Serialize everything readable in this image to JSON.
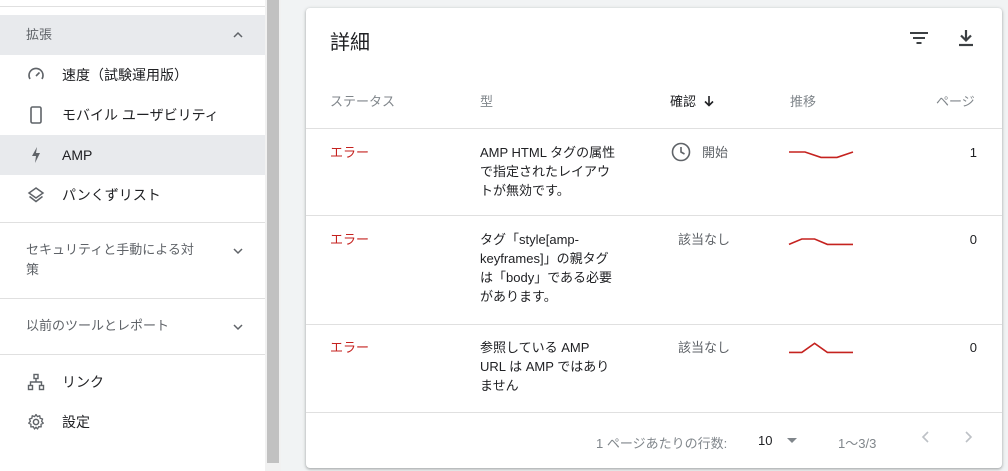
{
  "sidebar": {
    "sections": {
      "enhancements": "拡張",
      "security": "セキュリティと手動による対策",
      "legacy": "以前のツールとレポート"
    },
    "items": [
      {
        "label": "速度（試験運用版）",
        "icon": "speedometer-icon"
      },
      {
        "label": "モバイル ユーザビリティ",
        "icon": "smartphone-icon"
      },
      {
        "label": "AMP",
        "icon": "bolt-icon"
      },
      {
        "label": "パンくずリスト",
        "icon": "layers-icon"
      }
    ],
    "bottom_items": [
      {
        "label": "リンク",
        "icon": "sitemap-icon"
      },
      {
        "label": "設定",
        "icon": "gear-icon"
      }
    ]
  },
  "card": {
    "title": "詳細",
    "columns": {
      "status": "ステータス",
      "type": "型",
      "confirm": "確認",
      "trend": "推移",
      "pages": "ページ"
    },
    "rows": [
      {
        "status": "エラー",
        "type": "AMP HTML タグの属性で指定されたレイアウトが無効です。",
        "confirm": "開始",
        "pages": "1",
        "trend": [
          0.5,
          0.5,
          0.95,
          0.95,
          0.5
        ]
      },
      {
        "status": "エラー",
        "type": "タグ「style[amp-keyframes]」の親タグは「body」である必要があります。",
        "confirm": "該当なし",
        "pages": "0",
        "trend": [
          0.95,
          0.5,
          0.5,
          0.95,
          0.95,
          0.95
        ]
      },
      {
        "status": "エラー",
        "type": "参照している AMP URL は AMP ではありません",
        "confirm": "該当なし",
        "pages": "0",
        "trend": [
          0.95,
          0.95,
          0.2,
          0.95,
          0.95,
          0.95
        ]
      }
    ],
    "footer": {
      "rows_per_page_label": "1 ページあたりの行数:",
      "rows_per_page_value": "10",
      "range": "1～3/3"
    }
  },
  "colors": {
    "error": "#c5221f",
    "trend_line": "#c5221f",
    "active_nav_bg": "#e8eaed"
  }
}
